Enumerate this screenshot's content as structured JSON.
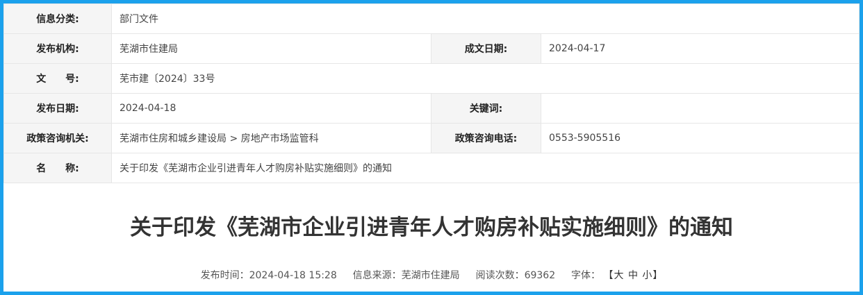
{
  "meta": {
    "category_label": "信息分类:",
    "category_value": "部门文件",
    "publisher_label": "发布机构:",
    "publisher_value": "芜湖市住建局",
    "created_date_label": "成文日期:",
    "created_date_value": "2024-04-17",
    "doc_no_label": "文　　号:",
    "doc_no_value": "芜市建〔2024〕33号",
    "publish_date_label": "发布日期:",
    "publish_date_value": "2024-04-18",
    "keywords_label": "关键词:",
    "keywords_value": "",
    "consult_org_label": "政策咨询机关:",
    "consult_org_value": "芜湖市住房和城乡建设局 > 房地产市场监管科",
    "consult_phone_label": "政策咨询电话:",
    "consult_phone_value": "0553-5905516",
    "name_label": "名　　称:",
    "name_value": "关于印发《芜湖市企业引进青年人才购房补贴实施细则》的通知"
  },
  "article": {
    "title": "关于印发《芜湖市企业引进青年人才购房补贴实施细则》的通知",
    "publish_time_label": "发布时间：",
    "publish_time_value": "2024-04-18 15:28",
    "source_label": "信息来源：",
    "source_value": "芜湖市住建局",
    "views_label": "阅读次数：",
    "views_value": "69362",
    "font_label": "字体：",
    "bracket_open": "【",
    "font_large": "大",
    "font_medium": "中",
    "font_small": "小",
    "bracket_close": "】"
  },
  "colors": {
    "frame_border": "#1ba1ec",
    "label_bg": "#f5f5f5",
    "cell_border": "#e6e6e6"
  }
}
